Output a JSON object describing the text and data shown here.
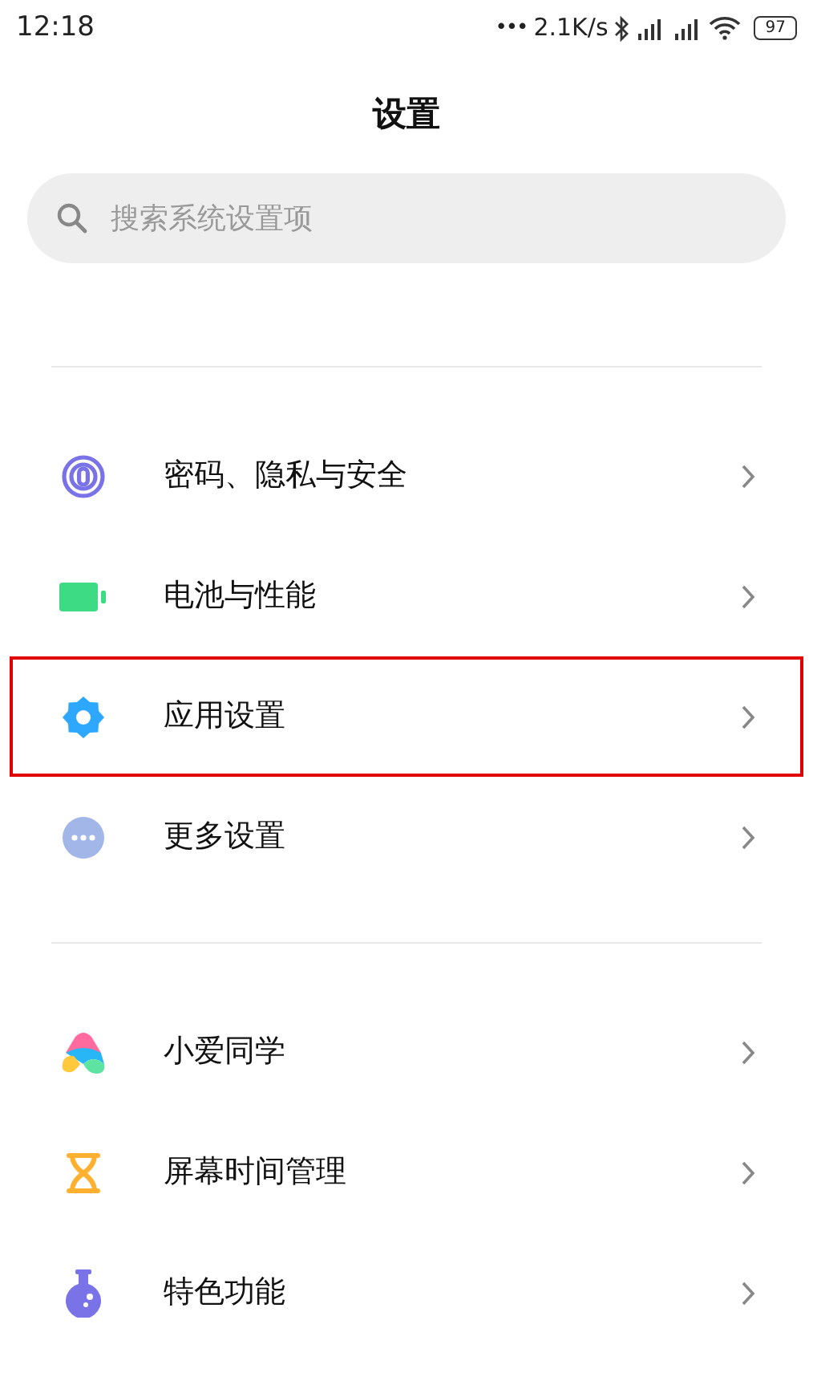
{
  "status_bar": {
    "time": "12:18",
    "dots": "•••",
    "speed": "2.1K/s",
    "battery": "97"
  },
  "title": "设置",
  "search": {
    "placeholder": "搜索系统设置项"
  },
  "groups": [
    {
      "items": [
        {
          "kind": "fingerprint",
          "label": "密码、隐私与安全",
          "highlighted": false
        },
        {
          "kind": "battery",
          "label": "电池与性能",
          "highlighted": false
        },
        {
          "kind": "gear",
          "label": "应用设置",
          "highlighted": true
        },
        {
          "kind": "more",
          "label": "更多设置",
          "highlighted": false
        }
      ]
    },
    {
      "items": [
        {
          "kind": "assistant",
          "label": "小爱同学",
          "highlighted": false
        },
        {
          "kind": "hourglass",
          "label": "屏幕时间管理",
          "highlighted": false
        },
        {
          "kind": "flask",
          "label": "特色功能",
          "highlighted": false
        }
      ]
    }
  ]
}
